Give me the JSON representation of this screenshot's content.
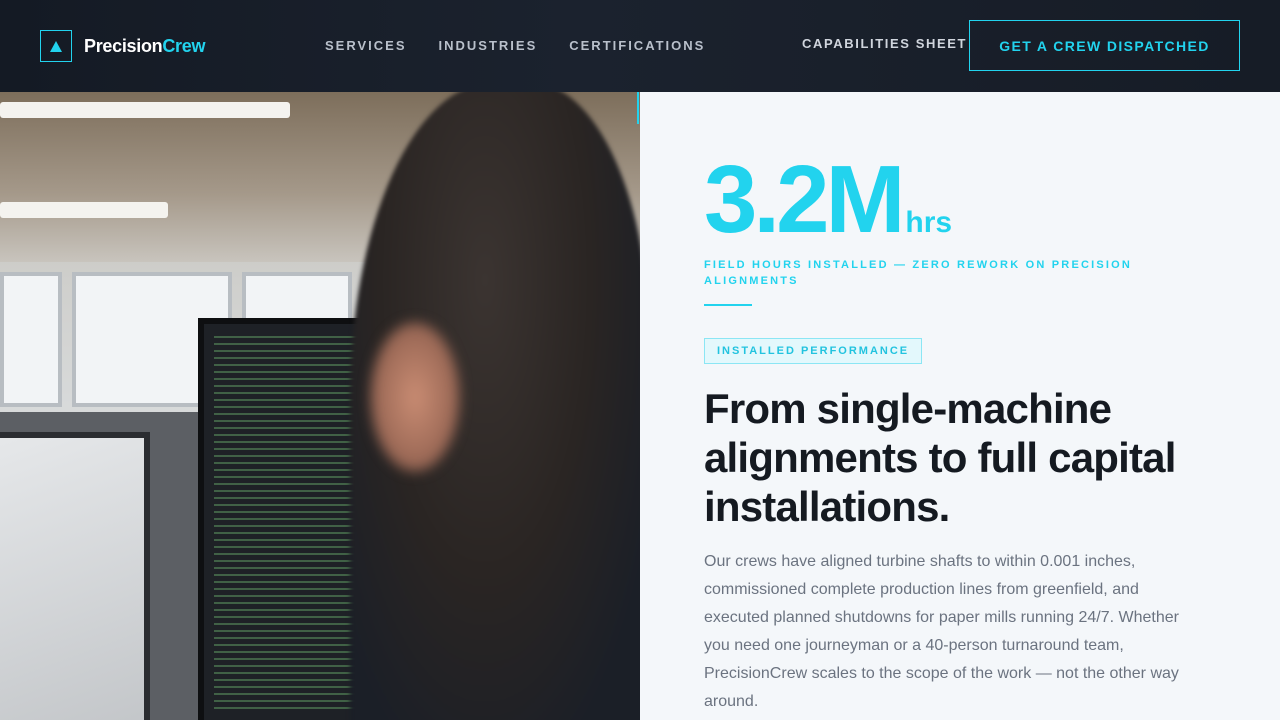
{
  "nav": {
    "brand_prefix": "Precision",
    "brand_suffix": "Crew",
    "links": [
      "SERVICES",
      "INDUSTRIES",
      "CERTIFICATIONS"
    ],
    "capabilities_label": "CAPABILITIES SHEET",
    "cta_label": "GET A CREW DISPATCHED"
  },
  "hero": {
    "stat_value": "3.2M",
    "stat_unit": "hrs",
    "stat_caption": "FIELD HOURS INSTALLED — ZERO REWORK ON PRECISION ALIGNMENTS",
    "badge": "INSTALLED PERFORMANCE",
    "headline": "From single-machine alignments to full capital installations.",
    "body": "Our crews have aligned turbine shafts to within 0.001 inches, commissioned complete production lines from greenfield, and executed planned shutdowns for paper mills running 24/7. Whether you need one journeyman or a 40-person turnaround team, PrecisionCrew scales to the scope of the work — not the other way around."
  },
  "icons": {
    "brand": "triangle-logo-icon"
  },
  "colors": {
    "accent": "#22d3ee",
    "nav_bg": "#161c26",
    "headline": "#151a21",
    "body_text": "#6b7380",
    "content_bg": "#f4f7fa"
  }
}
